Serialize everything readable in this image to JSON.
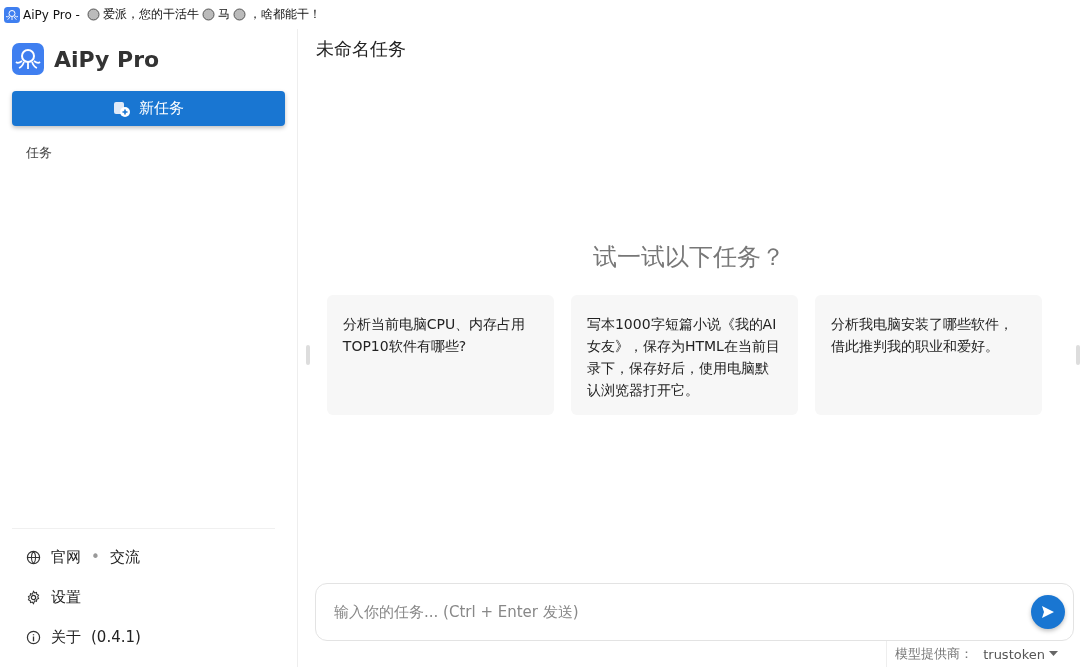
{
  "window": {
    "title_parts": [
      "AiPy Pro - ",
      "爱派，您的干活牛",
      "马",
      "，啥都能干！"
    ]
  },
  "sidebar": {
    "app_name": "AiPy Pro",
    "new_task_button": "新任务",
    "section_label": "任务",
    "footer_links": [
      {
        "kind": "web",
        "parts": [
          "官网",
          "•",
          "交流"
        ]
      },
      {
        "kind": "settings",
        "parts": [
          "设置"
        ]
      },
      {
        "kind": "about",
        "parts": [
          "关于",
          "(0.4.1)"
        ]
      }
    ]
  },
  "main": {
    "title": "未命名任务",
    "prompt_heading": "试一试以下任务？",
    "suggestions": [
      "分析当前电脑CPU、内存占用TOP10软件有哪些?",
      "写本1000字短篇小说《我的AI女友》，保存为HTML在当前目录下，保存好后，使用电脑默认浏览器打开它。",
      "分析我电脑安装了哪些软件，借此推判我的职业和爱好。"
    ],
    "input": {
      "placeholder": "输入你的任务... (Ctrl + Enter 发送)"
    },
    "model_provider": {
      "label": "模型提供商：",
      "value": "trustoken"
    }
  }
}
